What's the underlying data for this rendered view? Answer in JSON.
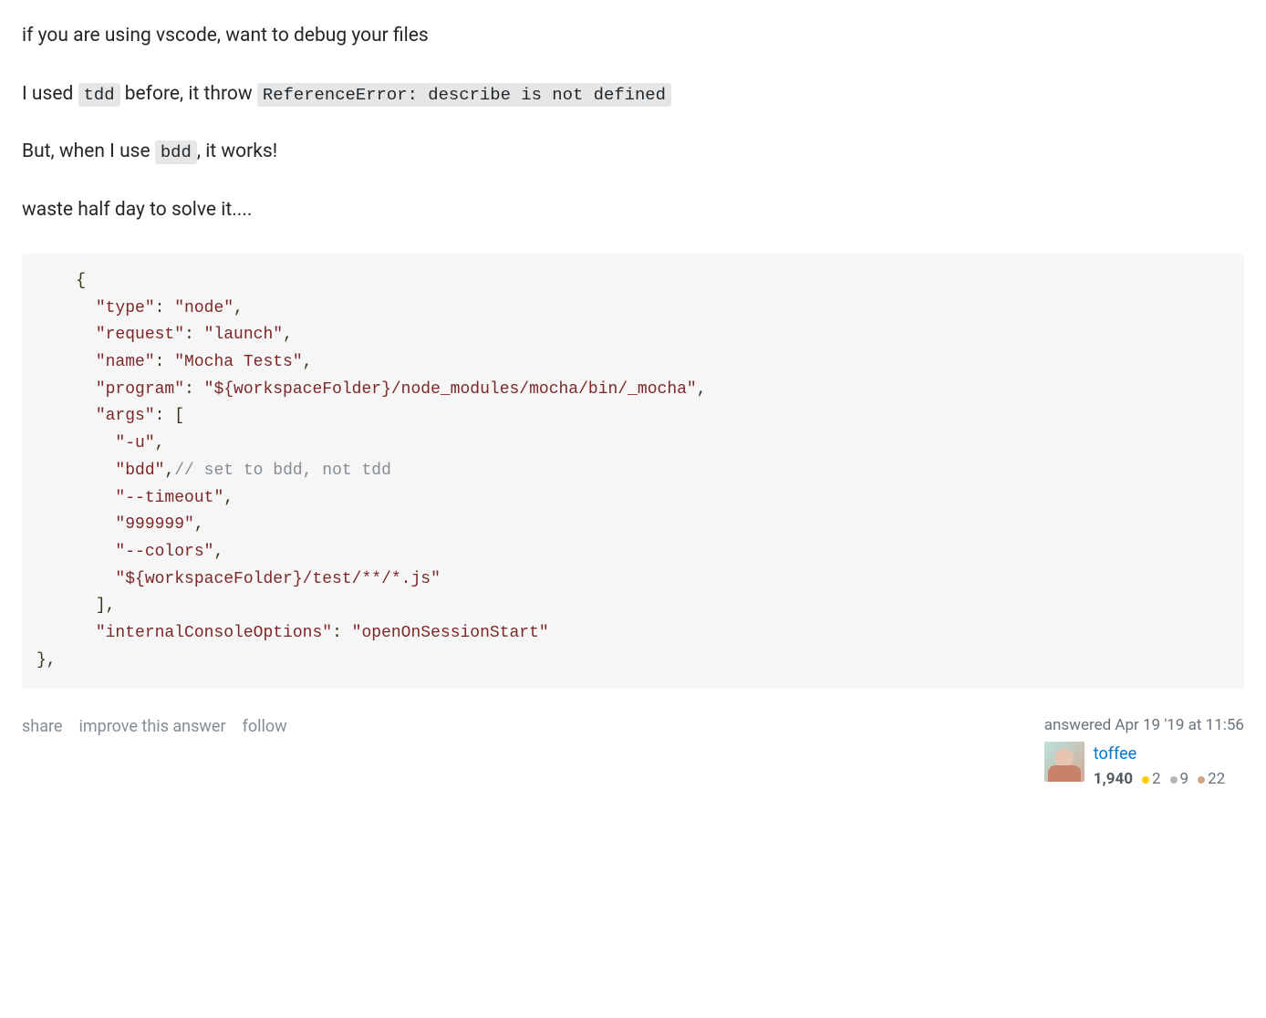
{
  "answer": {
    "paragraphs": {
      "p1": "if you are using vscode, want to debug your files",
      "p2_before": "I used ",
      "p2_code1": "tdd",
      "p2_mid": " before, it throw ",
      "p2_code2": "ReferenceError: describe is not defined",
      "p3_before": "But, when I use ",
      "p3_code": "bdd",
      "p3_after": ", it works!",
      "p4": "waste half day to solve it...."
    },
    "code": {
      "line1": "    {",
      "line2_key": "\"type\"",
      "line2_val": "\"node\"",
      "line3_key": "\"request\"",
      "line3_val": "\"launch\"",
      "line4_key": "\"name\"",
      "line4_val": "\"Mocha Tests\"",
      "line5_key": "\"program\"",
      "line5_val": "\"${workspaceFolder}/node_modules/mocha/bin/_mocha\"",
      "line6_key": "\"args\"",
      "line7_val": "\"-u\"",
      "line8_val": "\"bdd\"",
      "line8_comment": "// set to bdd, not tdd",
      "line9_val": "\"--timeout\"",
      "line10_val": "\"999999\"",
      "line11_val": "\"--colors\"",
      "line12_val": "\"${workspaceFolder}/test/**/*.js\"",
      "line14_key": "\"internalConsoleOptions\"",
      "line14_val": "\"openOnSessionStart\""
    }
  },
  "actions": {
    "share": "share",
    "improve": "improve this answer",
    "follow": "follow"
  },
  "user": {
    "action_time_prefix": "answered ",
    "action_time": "Apr 19 '19 at 11:56",
    "name": "toffee",
    "reputation": "1,940",
    "gold": "2",
    "silver": "9",
    "bronze": "22"
  }
}
